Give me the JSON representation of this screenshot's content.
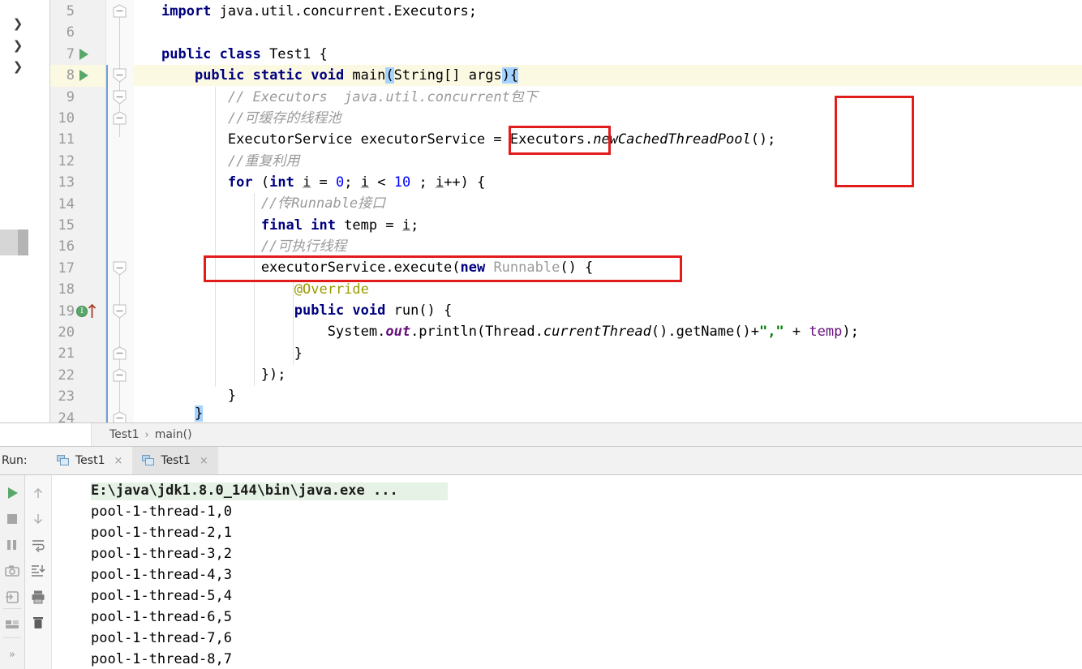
{
  "editor": {
    "first_visible_line": 5,
    "highlighted_line": 8,
    "lines": [
      {
        "n": 5,
        "text": "import java.util.concurrent.Executors;"
      },
      {
        "n": 6,
        "text": ""
      },
      {
        "n": 7,
        "text": "public class Test1 {"
      },
      {
        "n": 8,
        "text": "    public static void main(String[] args){"
      },
      {
        "n": 9,
        "text": "        // Executors  java.util.concurrent包下"
      },
      {
        "n": 10,
        "text": "        //可缓存的线程池"
      },
      {
        "n": 11,
        "text": "        ExecutorService executorService = Executors.newCachedThreadPool();"
      },
      {
        "n": 12,
        "text": "        //重复利用"
      },
      {
        "n": 13,
        "text": "        for (int i = 0; i < 10 ; i++) {"
      },
      {
        "n": 14,
        "text": "            //传Runnable接口"
      },
      {
        "n": 15,
        "text": "            final int temp = i;"
      },
      {
        "n": 16,
        "text": "            //可执行线程"
      },
      {
        "n": 17,
        "text": "            executorService.execute(new Runnable() {"
      },
      {
        "n": 18,
        "text": "                @Override"
      },
      {
        "n": 19,
        "text": "                public void run() {"
      },
      {
        "n": 20,
        "text": "                    System.out.println(Thread.currentThread().getName()+\",\" + temp);"
      },
      {
        "n": 21,
        "text": "                }"
      },
      {
        "n": 22,
        "text": "            });"
      },
      {
        "n": 23,
        "text": "        }"
      },
      {
        "n": 24,
        "text": "    }"
      }
    ],
    "gutter_markers": {
      "run_gutter_lines": [
        7,
        8
      ],
      "breakpoint_info_line": 19
    }
  },
  "annotations": [
    {
      "name": "executors-call-box",
      "label": ""
    },
    {
      "name": "empty-note-box",
      "label": ""
    },
    {
      "name": "execute-statement-box",
      "label": ""
    }
  ],
  "breadcrumb": {
    "items": [
      "Test1",
      "main()"
    ],
    "separator": "›"
  },
  "run_panel": {
    "label": "Run:",
    "tabs": [
      {
        "label": "Test1",
        "active": false,
        "close": "×"
      },
      {
        "label": "Test1",
        "active": true,
        "close": "×"
      }
    ],
    "toolbar_left": [
      "rerun-icon",
      "stop-icon",
      "pause-icon",
      "camera-icon",
      "export-icon",
      "layout-icon",
      "expand-more-icon"
    ],
    "toolbar_right": [
      "scroll-up-icon",
      "scroll-down-icon",
      "soft-wrap-icon",
      "scroll-to-end-icon",
      "print-icon",
      "trash-icon"
    ],
    "console": {
      "command_line": "E:\\java\\jdk1.8.0_144\\bin\\java.exe ...",
      "output": [
        "pool-1-thread-1,0",
        "pool-1-thread-2,1",
        "pool-1-thread-3,2",
        "pool-1-thread-4,3",
        "pool-1-thread-5,4",
        "pool-1-thread-6,5",
        "pool-1-thread-7,6",
        "pool-1-thread-8,7"
      ]
    }
  },
  "colors": {
    "annotation_red": "#e21b1b",
    "keyword_blue": "#000080",
    "comment_gray": "#9a9a9a",
    "number_blue": "#0000ff",
    "string_green": "#008000",
    "annotation_yellow": "#9a9a00",
    "field_purple": "#660e7a",
    "caret_row": "#fcf9e3",
    "selection_blue": "#a6d2ff",
    "run_green": "#59a869",
    "console_cmd_bg": "#e6f2e6"
  }
}
